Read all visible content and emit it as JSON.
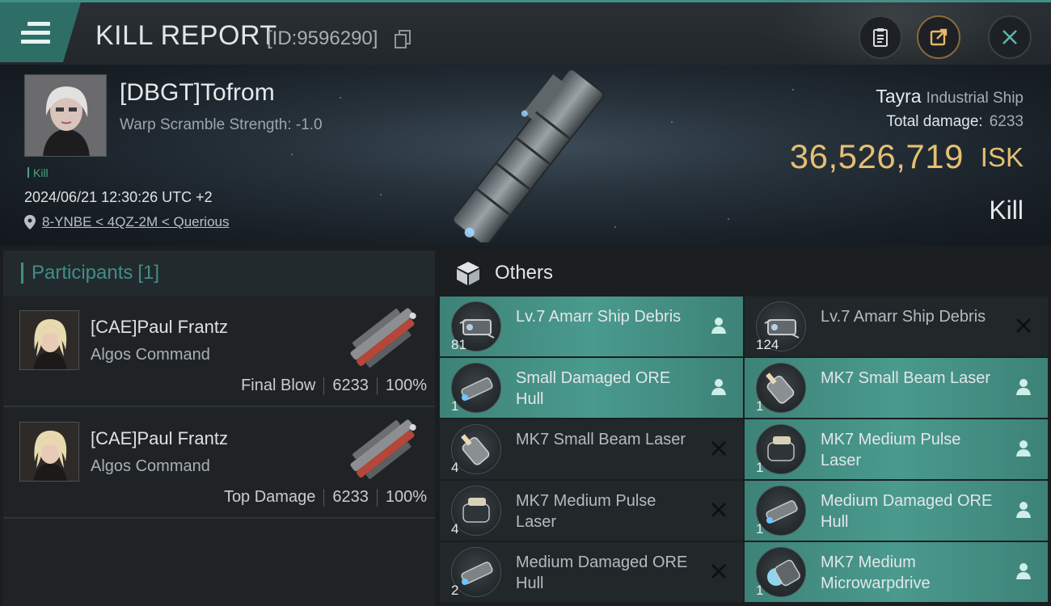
{
  "header": {
    "title": "KILL REPORT",
    "id_text": "[ID:9596290]"
  },
  "victim": {
    "pilot": "[DBGT]Tofrom",
    "warp_scramble": "Warp Scramble Strength: -1.0",
    "tag": "Kill",
    "datetime": "2024/06/21 12:30:26 UTC +2",
    "location": "8-YNBE < 4QZ-2M < Querious",
    "ship_name": "Tayra",
    "ship_class": "Industrial Ship",
    "total_damage_label": "Total damage:",
    "total_damage_value": "6233",
    "isk_value": "36,526,719",
    "isk_unit": "ISK",
    "result": "Kill"
  },
  "participants": {
    "title": "Participants",
    "count": "[1]",
    "rows": [
      {
        "name": "[CAE]Paul Frantz",
        "ship": "Algos Command",
        "role": "Final Blow",
        "damage": "6233",
        "percent": "100%"
      },
      {
        "name": "[CAE]Paul Frantz",
        "ship": "Algos Command",
        "role": "Top Damage",
        "damage": "6233",
        "percent": "100%"
      }
    ]
  },
  "others": {
    "title": "Others",
    "items": [
      {
        "name": "Lv.7 Amarr Ship Debris",
        "qty": "81",
        "status": "dropped",
        "icon": "debris-icon"
      },
      {
        "name": "Lv.7 Amarr Ship Debris",
        "qty": "124",
        "status": "destroyed",
        "icon": "debris-icon"
      },
      {
        "name": "Small Damaged ORE Hull",
        "qty": "1",
        "status": "dropped",
        "icon": "hull-icon"
      },
      {
        "name": "MK7 Small Beam Laser",
        "qty": "1",
        "status": "dropped",
        "icon": "laser-icon"
      },
      {
        "name": "MK7 Small Beam Laser",
        "qty": "4",
        "status": "destroyed",
        "icon": "laser-icon"
      },
      {
        "name": "MK7 Medium Pulse Laser",
        "qty": "1",
        "status": "dropped",
        "icon": "pulse-laser-icon"
      },
      {
        "name": "MK7 Medium Pulse Laser",
        "qty": "4",
        "status": "destroyed",
        "icon": "pulse-laser-icon"
      },
      {
        "name": "Medium Damaged ORE Hull",
        "qty": "1",
        "status": "dropped",
        "icon": "hull-icon"
      },
      {
        "name": "Medium Damaged ORE Hull",
        "qty": "2",
        "status": "destroyed",
        "icon": "hull-icon"
      },
      {
        "name": "MK7 Medium Microwarpdrive",
        "qty": "1",
        "status": "dropped",
        "icon": "microwarpdrive-icon"
      }
    ]
  },
  "colors": {
    "accent": "#3f8f85",
    "dropped_bg": "#4a9a8e",
    "isk": "#e5bf72"
  }
}
